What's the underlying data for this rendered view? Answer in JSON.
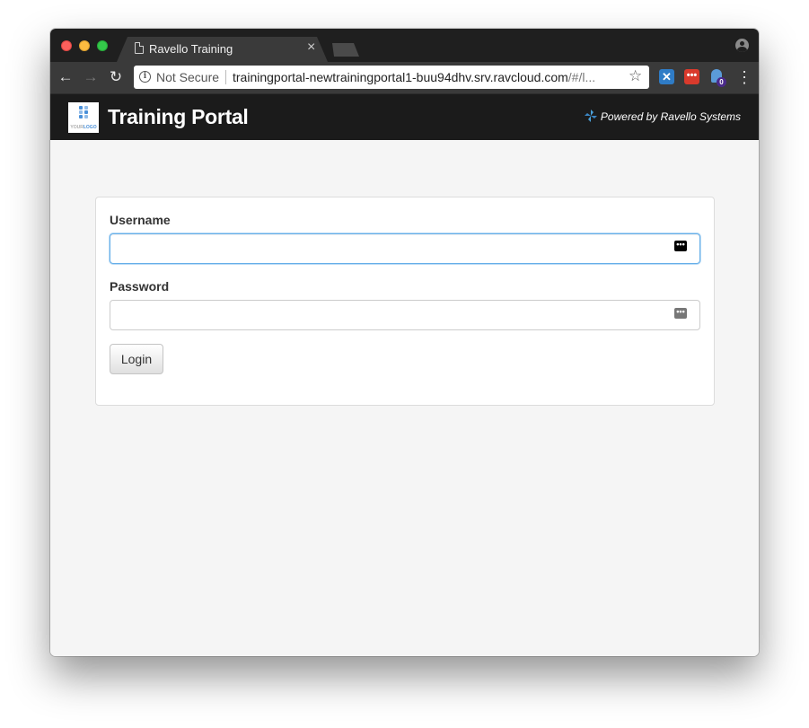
{
  "browser": {
    "tab": {
      "title": "Ravello Training",
      "close_glyph": "×",
      "icon": "document-icon"
    },
    "toolbar": {
      "back_glyph": "←",
      "forward_glyph": "→",
      "reload_glyph": "↻",
      "security_label": "Not Secure",
      "url_main": "trainingportal-newtrainingportal1-buu94dhv.srv.ravcloud.com",
      "url_rest": "/#/l...",
      "bookmark_glyph": "☆",
      "menu_glyph": "⋮",
      "extensions": [
        {
          "name": "blue-x-extension",
          "glyph": "✕",
          "color": "#2f7cc6"
        },
        {
          "name": "lastpass-extension",
          "glyph": "•••",
          "color": "#d93a2c"
        },
        {
          "name": "ghostery-extension",
          "badge": "0",
          "color": "#5b9bd8"
        }
      ]
    },
    "traffic_lights": {
      "close": "#fc605c",
      "minimize": "#fdbc40",
      "zoom": "#34c84a"
    }
  },
  "header": {
    "logo_text_a": "YOUR",
    "logo_text_b": "LOGO",
    "title": "Training Portal",
    "powered_by": "Powered by Ravello Systems"
  },
  "login": {
    "username_label": "Username",
    "username_value": "",
    "password_label": "Password",
    "password_value": "",
    "field_icon_glyph": "•••",
    "login_button": "Login"
  },
  "colors": {
    "header_bg": "#1b1b1b",
    "page_bg": "#f5f5f5",
    "focus_border": "#66afe9"
  }
}
